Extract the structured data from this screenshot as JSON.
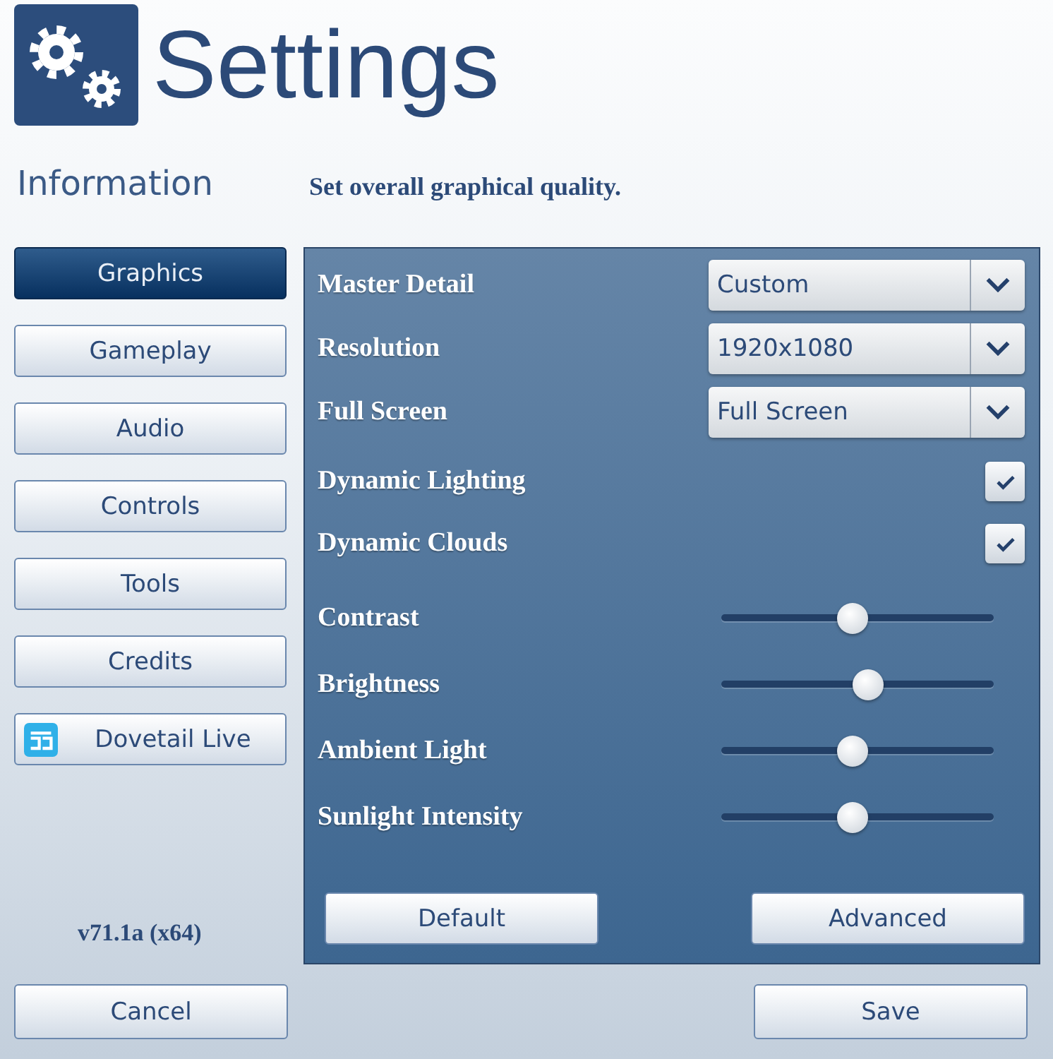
{
  "header": {
    "title": "Settings"
  },
  "section": {
    "title": "Information",
    "description": "Set overall graphical quality."
  },
  "sidebar": {
    "items": [
      {
        "label": "Graphics",
        "selected": true,
        "kind": "plain"
      },
      {
        "label": "Gameplay",
        "selected": false,
        "kind": "plain"
      },
      {
        "label": "Audio",
        "selected": false,
        "kind": "plain"
      },
      {
        "label": "Controls",
        "selected": false,
        "kind": "plain"
      },
      {
        "label": "Tools",
        "selected": false,
        "kind": "plain"
      },
      {
        "label": "Credits",
        "selected": false,
        "kind": "plain"
      },
      {
        "label": "Dovetail Live",
        "selected": false,
        "kind": "branded"
      }
    ],
    "version": "v71.1a (x64)"
  },
  "settings": [
    {
      "kind": "dropdown",
      "label": "Master Detail",
      "value": "Custom"
    },
    {
      "kind": "dropdown",
      "label": "Resolution",
      "value": "1920x1080"
    },
    {
      "kind": "dropdown",
      "label": "Full Screen",
      "value": "Full Screen"
    },
    {
      "kind": "checkbox",
      "label": "Dynamic Lighting",
      "checked": true
    },
    {
      "kind": "checkbox",
      "label": "Dynamic Clouds",
      "checked": true
    },
    {
      "kind": "slider",
      "label": "Contrast",
      "level": 0.48
    },
    {
      "kind": "slider",
      "label": "Brightness",
      "level": 0.54
    },
    {
      "kind": "slider",
      "label": "Ambient Light",
      "level": 0.48
    },
    {
      "kind": "slider",
      "label": "Sunlight Intensity",
      "level": 0.48
    }
  ],
  "panel_buttons": [
    "Default",
    "Advanced"
  ],
  "footer_buttons": [
    "Cancel",
    "Save"
  ]
}
